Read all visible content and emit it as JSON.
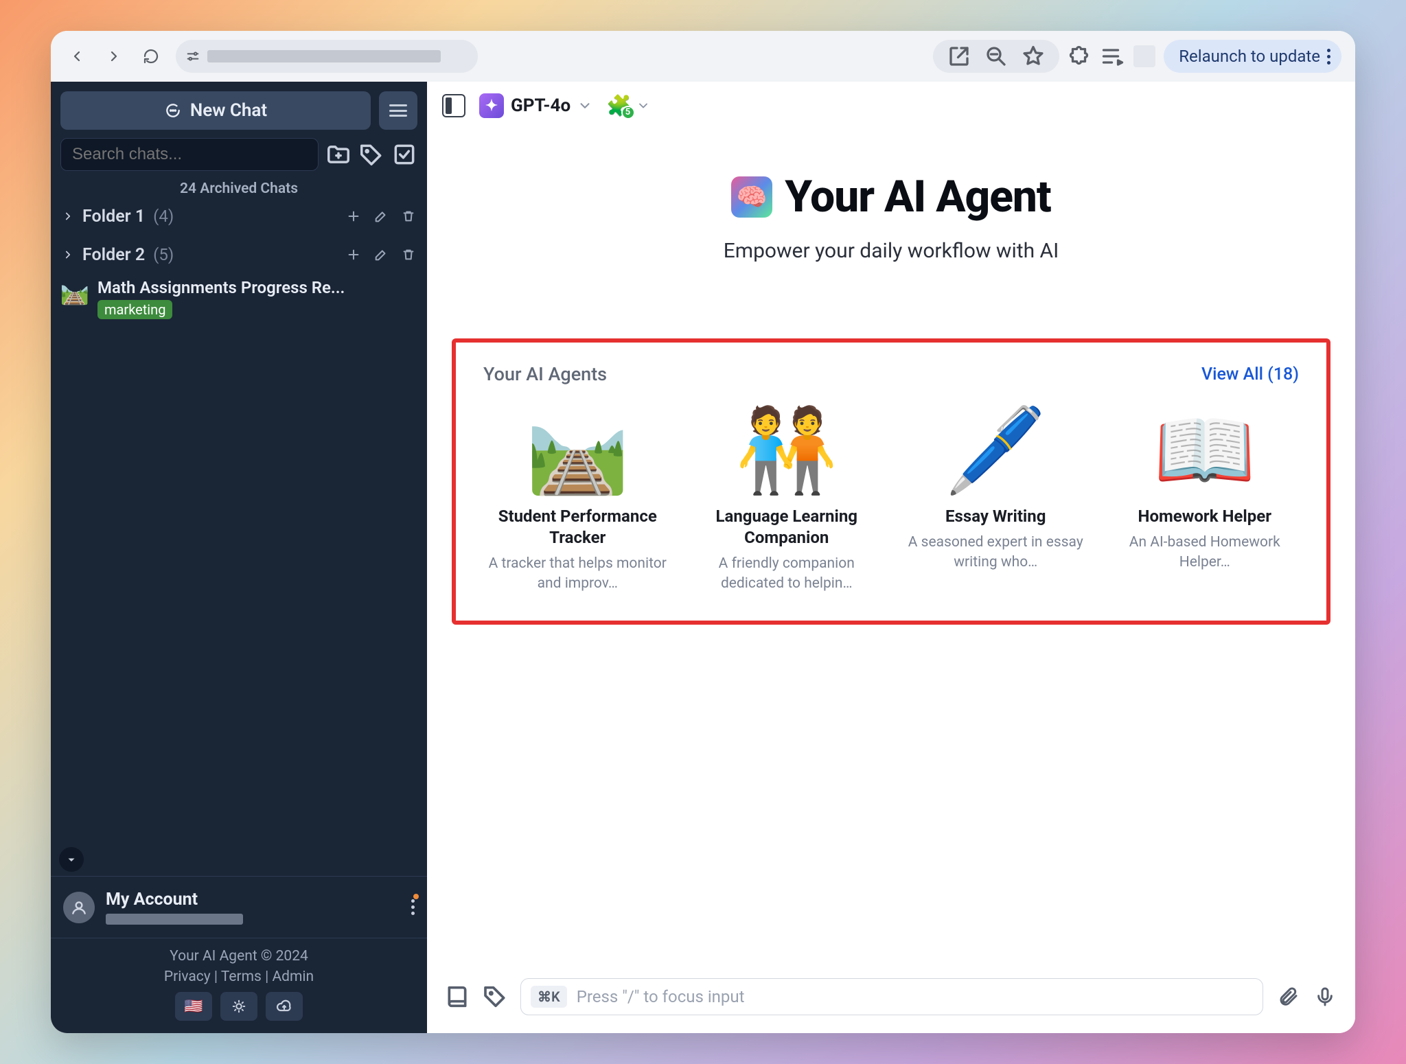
{
  "browser": {
    "relaunch_label": "Relaunch to update"
  },
  "sidebar": {
    "new_chat_label": "New Chat",
    "search_placeholder": "Search chats...",
    "archived_label": "24 Archived Chats",
    "folders": [
      {
        "name": "Folder 1",
        "count": "(4)"
      },
      {
        "name": "Folder 2",
        "count": "(5)"
      }
    ],
    "chat": {
      "title": "Math Assignments Progress Re...",
      "tag": "marketing",
      "thumb_emoji": "🛤️"
    },
    "account": {
      "name": "My Account"
    },
    "footer": {
      "copyright": "Your AI Agent © 2024",
      "links": {
        "privacy": "Privacy",
        "terms": "Terms",
        "admin": "Admin"
      }
    }
  },
  "main": {
    "model_label": "GPT-4o",
    "plugin_badge": "5",
    "hero_title": "Your AI Agent",
    "hero_subtitle": "Empower your daily workflow with AI",
    "agents_section_title": "Your AI Agents",
    "view_all_label": "View All (18)",
    "agents": [
      {
        "emoji": "🛤️",
        "name": "Student Performance Tracker",
        "desc": "A tracker that helps monitor and improv…"
      },
      {
        "emoji": "🧑‍🤝‍🧑",
        "name": "Language Learning Companion",
        "desc": "A friendly companion dedicated to helpin…"
      },
      {
        "emoji": "🖊️",
        "name": "Essay Writing",
        "desc": "A seasoned expert in essay writing who…"
      },
      {
        "emoji": "📖",
        "name": "Homework Helper",
        "desc": "An AI-based Homework Helper…"
      }
    ],
    "composer": {
      "kbd": "⌘K",
      "placeholder": "Press \"/\" to focus input"
    }
  }
}
